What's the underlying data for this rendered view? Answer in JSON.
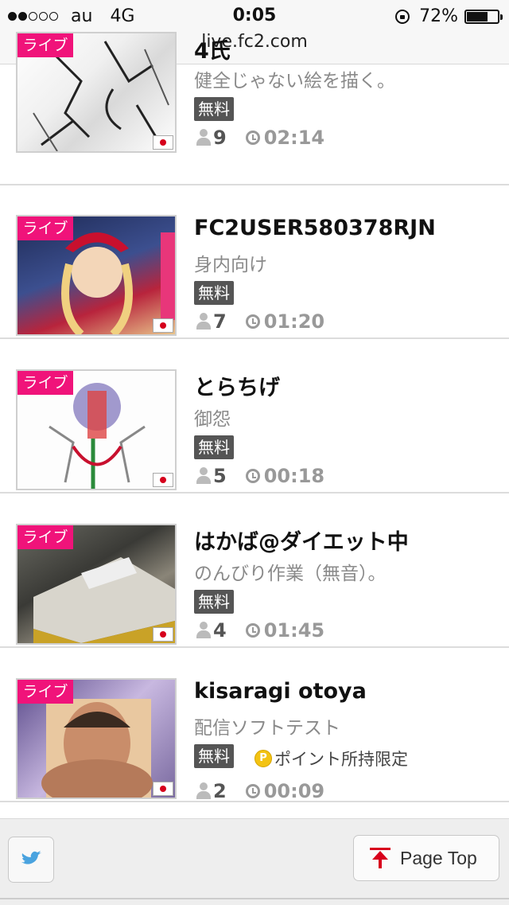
{
  "status_bar": {
    "signal_dots_filled": 2,
    "signal_dots_total": 5,
    "carrier": "au",
    "network": "4G",
    "time": "0:05",
    "battery_percent": "72%",
    "battery_level": 0.72,
    "url": "live.fc2.com"
  },
  "list_items": [
    {
      "badge": "ライブ",
      "title": "4氏",
      "description": "健全じゃない絵を描く。",
      "tag": "無料",
      "extra": "",
      "viewers": "9",
      "duration": "02:14"
    },
    {
      "badge": "ライブ",
      "title": "FC2USER580378RJN",
      "description": "身内向け",
      "tag": "無料",
      "extra": "",
      "viewers": "7",
      "duration": "01:20"
    },
    {
      "badge": "ライブ",
      "title": "とらちげ",
      "description": "御怨",
      "tag": "無料",
      "extra": "",
      "viewers": "5",
      "duration": "00:18"
    },
    {
      "badge": "ライブ",
      "title": "はかば@ダイエット中",
      "description": "のんびり作業（無音）。",
      "tag": "無料",
      "extra": "",
      "viewers": "4",
      "duration": "01:45"
    },
    {
      "badge": "ライブ",
      "title": "kisaragi otoya",
      "description": "配信ソフトテスト",
      "tag": "無料",
      "extra": "ポイント所持限定",
      "viewers": "2",
      "duration": "00:09"
    }
  ],
  "footer": {
    "page_top_label": "Page Top"
  },
  "colors": {
    "live_badge": "#f0137a",
    "twitter": "#4aa3df",
    "page_top_arrow": "#d8001c"
  },
  "icons": [
    "lock-rotation-icon",
    "battery-icon",
    "flag-jp-icon",
    "viewer-person-icon",
    "clock-icon",
    "point-coin-icon",
    "twitter-bird-icon",
    "arrow-up-icon"
  ]
}
